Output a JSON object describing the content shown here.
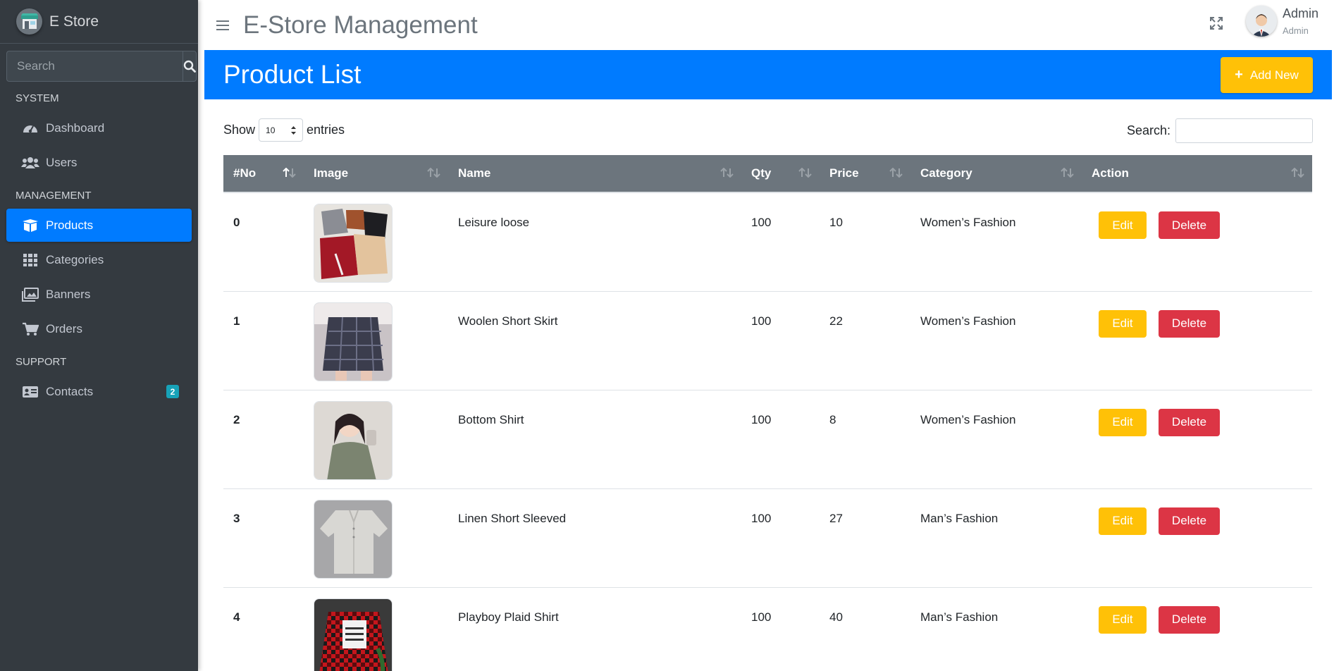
{
  "brand": {
    "name": "E Store"
  },
  "sidebar": {
    "search_placeholder": "Search",
    "sections": {
      "system": "SYSTEM",
      "management": "MANAGEMENT",
      "support": "SUPPORT"
    },
    "items": {
      "dashboard": "Dashboard",
      "users": "Users",
      "products": "Products",
      "categories": "Categories",
      "banners": "Banners",
      "orders": "Orders",
      "contacts": "Contacts",
      "contacts_badge": "2"
    }
  },
  "header": {
    "title": "E-Store Management",
    "user_name": "Admin",
    "user_role": "Admin"
  },
  "page": {
    "title": "Product List",
    "add_button": "Add New"
  },
  "table_controls": {
    "show_label": "Show",
    "page_length": "10",
    "entries_label": "entries",
    "search_label": "Search:"
  },
  "table": {
    "columns": [
      "#No",
      "Image",
      "Name",
      "Qty",
      "Price",
      "Category",
      "Action"
    ],
    "rows": [
      {
        "no": "0",
        "name": "Leisure loose",
        "qty": "100",
        "price": "10",
        "category": "Women’s Fashion"
      },
      {
        "no": "1",
        "name": "Woolen Short Skirt",
        "qty": "100",
        "price": "22",
        "category": "Women’s Fashion"
      },
      {
        "no": "2",
        "name": "Bottom Shirt",
        "qty": "100",
        "price": "8",
        "category": "Women’s Fashion"
      },
      {
        "no": "3",
        "name": "Linen Short Sleeved",
        "qty": "100",
        "price": "27",
        "category": "Man’s Fashion"
      },
      {
        "no": "4",
        "name": "Playboy Plaid Shirt",
        "qty": "100",
        "price": "40",
        "category": "Man’s Fashion"
      }
    ],
    "edit_label": "Edit",
    "delete_label": "Delete"
  },
  "colors": {
    "sidebar_bg": "#343a40",
    "primary": "#007bff",
    "warning": "#ffc107",
    "danger": "#dc3545",
    "table_header": "#6c757d",
    "badge": "#17a2b8"
  },
  "icons": {
    "brand": "store-logo-icon",
    "search": "search-icon",
    "dashboard": "tachometer-icon",
    "users": "users-icon",
    "products": "box-icon",
    "categories": "grid-icon",
    "banners": "images-icon",
    "orders": "cart-icon",
    "contacts": "address-card-icon",
    "menu": "hamburger-icon",
    "fullscreen": "expand-icon",
    "add": "plus-icon"
  }
}
